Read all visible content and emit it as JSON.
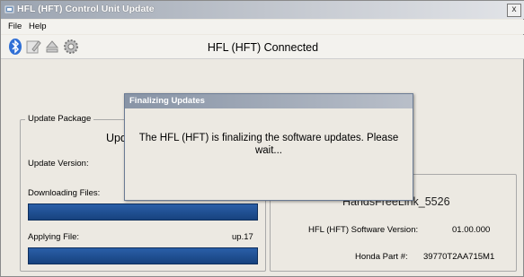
{
  "window": {
    "title": "HFL (HFT) Control Unit Update",
    "close_label": "x"
  },
  "menu": {
    "items": [
      "File",
      "Help"
    ]
  },
  "toolbar": {
    "icons": [
      "bluetooth-icon",
      "edit-document-icon",
      "eject-icon",
      "settings-gear-icon"
    ]
  },
  "status": {
    "text": "HFL (HFT) Connected"
  },
  "update_package": {
    "group_label": "Update Package",
    "heading_partial": "Updat",
    "version_label": "Update Version:",
    "downloading_label": "Downloading Files:",
    "downloading_progress": 1.0,
    "applying_label": "Applying File:",
    "applying_file": "up.17",
    "applying_progress": 1.0
  },
  "unit_info": {
    "name": "HandsFreeLink_5526",
    "software_version_label": "HFL (HFT) Software Version:",
    "software_version": "01.00.000",
    "part_label": "Honda Part #:",
    "part_number": "39770T2AA715M1"
  },
  "dialog": {
    "title": "Finalizing Updates",
    "message": "The HFL (HFT) is finalizing the software updates.  Please wait..."
  },
  "colors": {
    "progress": "#1f4f93",
    "titlebar": "#9aa3b0"
  }
}
